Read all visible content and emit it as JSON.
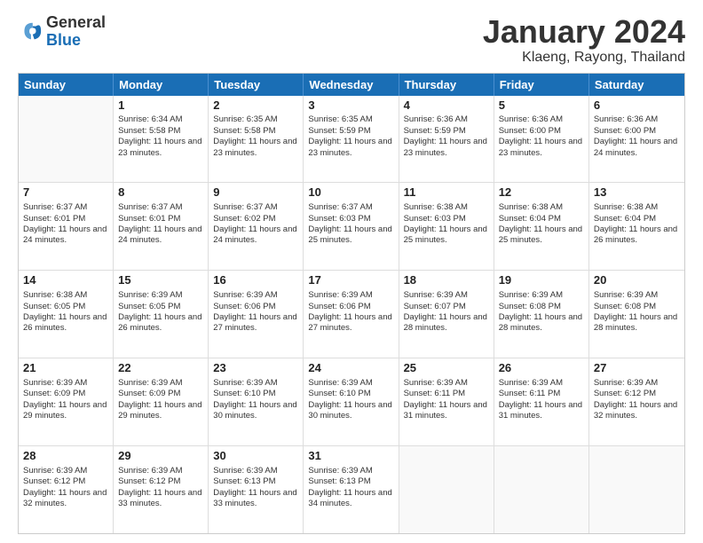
{
  "header": {
    "logo_general": "General",
    "logo_blue": "Blue",
    "main_title": "January 2024",
    "subtitle": "Klaeng, Rayong, Thailand"
  },
  "days_of_week": [
    "Sunday",
    "Monday",
    "Tuesday",
    "Wednesday",
    "Thursday",
    "Friday",
    "Saturday"
  ],
  "weeks": [
    [
      {
        "day": "",
        "empty": true
      },
      {
        "day": "1",
        "sunrise": "Sunrise: 6:34 AM",
        "sunset": "Sunset: 5:58 PM",
        "daylight": "Daylight: 11 hours and 23 minutes."
      },
      {
        "day": "2",
        "sunrise": "Sunrise: 6:35 AM",
        "sunset": "Sunset: 5:58 PM",
        "daylight": "Daylight: 11 hours and 23 minutes."
      },
      {
        "day": "3",
        "sunrise": "Sunrise: 6:35 AM",
        "sunset": "Sunset: 5:59 PM",
        "daylight": "Daylight: 11 hours and 23 minutes."
      },
      {
        "day": "4",
        "sunrise": "Sunrise: 6:36 AM",
        "sunset": "Sunset: 5:59 PM",
        "daylight": "Daylight: 11 hours and 23 minutes."
      },
      {
        "day": "5",
        "sunrise": "Sunrise: 6:36 AM",
        "sunset": "Sunset: 6:00 PM",
        "daylight": "Daylight: 11 hours and 23 minutes."
      },
      {
        "day": "6",
        "sunrise": "Sunrise: 6:36 AM",
        "sunset": "Sunset: 6:00 PM",
        "daylight": "Daylight: 11 hours and 24 minutes."
      }
    ],
    [
      {
        "day": "7",
        "sunrise": "Sunrise: 6:37 AM",
        "sunset": "Sunset: 6:01 PM",
        "daylight": "Daylight: 11 hours and 24 minutes."
      },
      {
        "day": "8",
        "sunrise": "Sunrise: 6:37 AM",
        "sunset": "Sunset: 6:01 PM",
        "daylight": "Daylight: 11 hours and 24 minutes."
      },
      {
        "day": "9",
        "sunrise": "Sunrise: 6:37 AM",
        "sunset": "Sunset: 6:02 PM",
        "daylight": "Daylight: 11 hours and 24 minutes."
      },
      {
        "day": "10",
        "sunrise": "Sunrise: 6:37 AM",
        "sunset": "Sunset: 6:03 PM",
        "daylight": "Daylight: 11 hours and 25 minutes."
      },
      {
        "day": "11",
        "sunrise": "Sunrise: 6:38 AM",
        "sunset": "Sunset: 6:03 PM",
        "daylight": "Daylight: 11 hours and 25 minutes."
      },
      {
        "day": "12",
        "sunrise": "Sunrise: 6:38 AM",
        "sunset": "Sunset: 6:04 PM",
        "daylight": "Daylight: 11 hours and 25 minutes."
      },
      {
        "day": "13",
        "sunrise": "Sunrise: 6:38 AM",
        "sunset": "Sunset: 6:04 PM",
        "daylight": "Daylight: 11 hours and 26 minutes."
      }
    ],
    [
      {
        "day": "14",
        "sunrise": "Sunrise: 6:38 AM",
        "sunset": "Sunset: 6:05 PM",
        "daylight": "Daylight: 11 hours and 26 minutes."
      },
      {
        "day": "15",
        "sunrise": "Sunrise: 6:39 AM",
        "sunset": "Sunset: 6:05 PM",
        "daylight": "Daylight: 11 hours and 26 minutes."
      },
      {
        "day": "16",
        "sunrise": "Sunrise: 6:39 AM",
        "sunset": "Sunset: 6:06 PM",
        "daylight": "Daylight: 11 hours and 27 minutes."
      },
      {
        "day": "17",
        "sunrise": "Sunrise: 6:39 AM",
        "sunset": "Sunset: 6:06 PM",
        "daylight": "Daylight: 11 hours and 27 minutes."
      },
      {
        "day": "18",
        "sunrise": "Sunrise: 6:39 AM",
        "sunset": "Sunset: 6:07 PM",
        "daylight": "Daylight: 11 hours and 28 minutes."
      },
      {
        "day": "19",
        "sunrise": "Sunrise: 6:39 AM",
        "sunset": "Sunset: 6:08 PM",
        "daylight": "Daylight: 11 hours and 28 minutes."
      },
      {
        "day": "20",
        "sunrise": "Sunrise: 6:39 AM",
        "sunset": "Sunset: 6:08 PM",
        "daylight": "Daylight: 11 hours and 28 minutes."
      }
    ],
    [
      {
        "day": "21",
        "sunrise": "Sunrise: 6:39 AM",
        "sunset": "Sunset: 6:09 PM",
        "daylight": "Daylight: 11 hours and 29 minutes."
      },
      {
        "day": "22",
        "sunrise": "Sunrise: 6:39 AM",
        "sunset": "Sunset: 6:09 PM",
        "daylight": "Daylight: 11 hours and 29 minutes."
      },
      {
        "day": "23",
        "sunrise": "Sunrise: 6:39 AM",
        "sunset": "Sunset: 6:10 PM",
        "daylight": "Daylight: 11 hours and 30 minutes."
      },
      {
        "day": "24",
        "sunrise": "Sunrise: 6:39 AM",
        "sunset": "Sunset: 6:10 PM",
        "daylight": "Daylight: 11 hours and 30 minutes."
      },
      {
        "day": "25",
        "sunrise": "Sunrise: 6:39 AM",
        "sunset": "Sunset: 6:11 PM",
        "daylight": "Daylight: 11 hours and 31 minutes."
      },
      {
        "day": "26",
        "sunrise": "Sunrise: 6:39 AM",
        "sunset": "Sunset: 6:11 PM",
        "daylight": "Daylight: 11 hours and 31 minutes."
      },
      {
        "day": "27",
        "sunrise": "Sunrise: 6:39 AM",
        "sunset": "Sunset: 6:12 PM",
        "daylight": "Daylight: 11 hours and 32 minutes."
      }
    ],
    [
      {
        "day": "28",
        "sunrise": "Sunrise: 6:39 AM",
        "sunset": "Sunset: 6:12 PM",
        "daylight": "Daylight: 11 hours and 32 minutes."
      },
      {
        "day": "29",
        "sunrise": "Sunrise: 6:39 AM",
        "sunset": "Sunset: 6:12 PM",
        "daylight": "Daylight: 11 hours and 33 minutes."
      },
      {
        "day": "30",
        "sunrise": "Sunrise: 6:39 AM",
        "sunset": "Sunset: 6:13 PM",
        "daylight": "Daylight: 11 hours and 33 minutes."
      },
      {
        "day": "31",
        "sunrise": "Sunrise: 6:39 AM",
        "sunset": "Sunset: 6:13 PM",
        "daylight": "Daylight: 11 hours and 34 minutes."
      },
      {
        "day": "",
        "empty": true
      },
      {
        "day": "",
        "empty": true
      },
      {
        "day": "",
        "empty": true
      }
    ]
  ]
}
